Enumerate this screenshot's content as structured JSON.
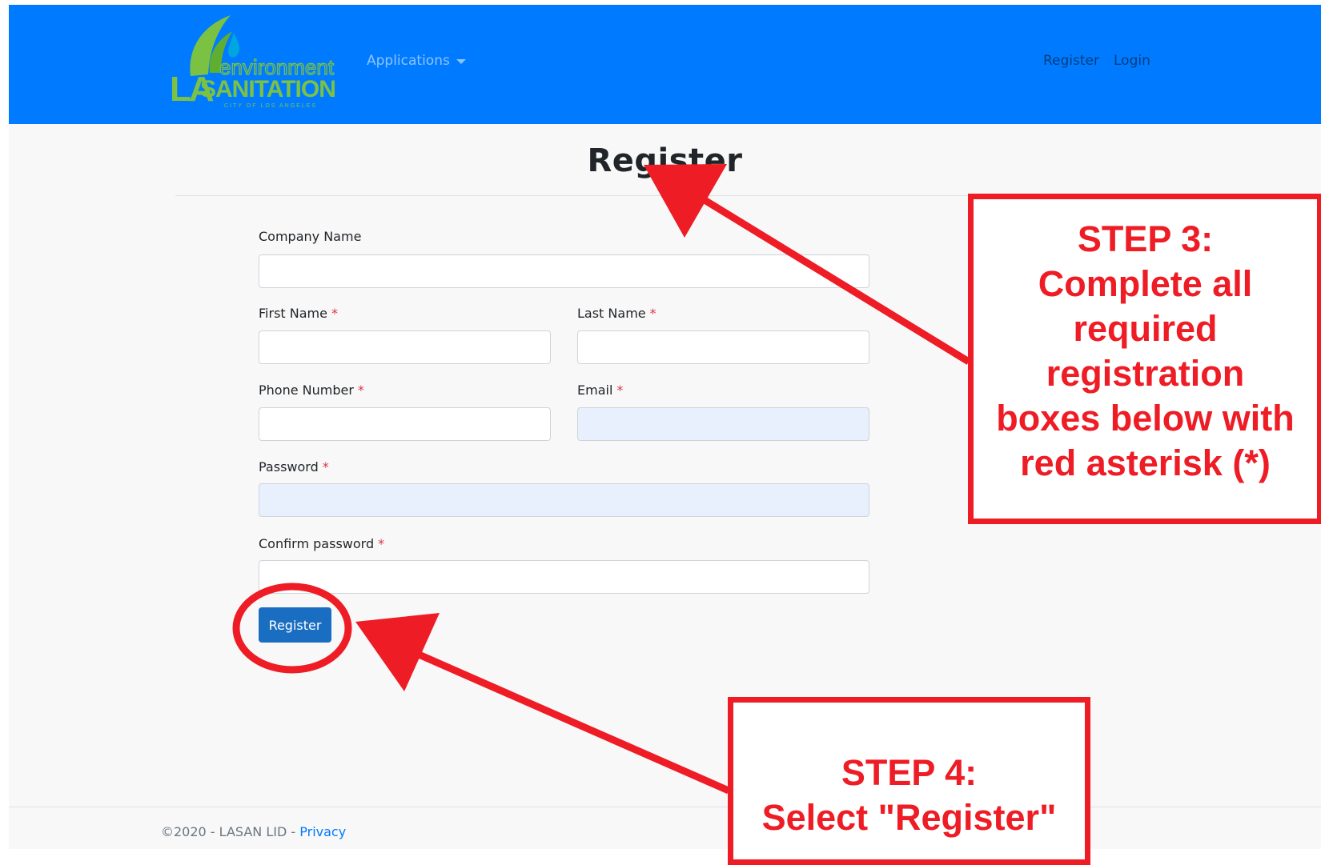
{
  "navbar": {
    "logo": {
      "icon": "leaf-drop-logo",
      "text_environment": "environment",
      "text_la": "LA",
      "text_sanitation": "SANITATION",
      "text_city": "CITY OF LOS ANGELES"
    },
    "applications_label": "Applications",
    "register_link": "Register",
    "login_link": "Login"
  },
  "main": {
    "title": "Register",
    "form": {
      "company_name_label": "Company Name",
      "first_name_label": "First Name",
      "last_name_label": "Last Name",
      "phone_label": "Phone Number",
      "email_label": "Email",
      "password_label": "Password",
      "confirm_password_label": "Confirm password",
      "required_marker": "*",
      "company_name_value": "",
      "first_name_value": "",
      "last_name_value": "",
      "phone_value": "",
      "email_value": "",
      "password_value": "",
      "confirm_password_value": "",
      "submit_label": "Register"
    }
  },
  "footer": {
    "copyright": "©2020 - LASAN LID - ",
    "privacy_link": "Privacy"
  },
  "annotations": {
    "step3": {
      "heading": "STEP 3:",
      "line1": "Complete all",
      "line2": "required",
      "line3": "registration",
      "line4": "boxes below with",
      "line5": "red asterisk (*)"
    },
    "step4": {
      "heading": "STEP 4:",
      "line1": "Select \"Register\""
    }
  },
  "colors": {
    "navbar": "#007bff",
    "annotation_red": "#ee1c25",
    "required_red": "#dc3545",
    "button_blue": "#1a6ec2",
    "autofill_blue": "#e8f0fe",
    "logo_green": "#7cc242",
    "logo_blue": "#00a6e0"
  }
}
